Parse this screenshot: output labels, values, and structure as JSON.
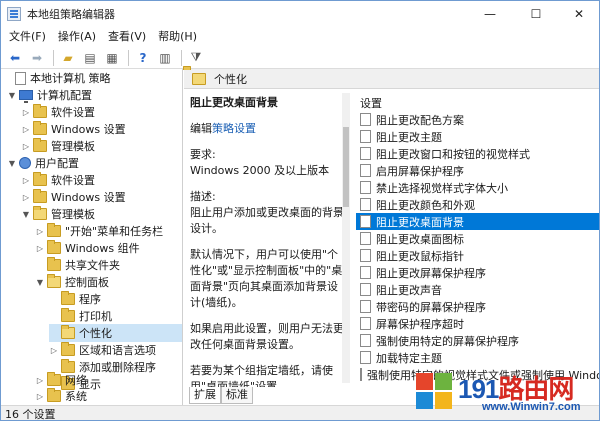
{
  "window": {
    "title": "本地组策略编辑器"
  },
  "menu": [
    "文件(F)",
    "操作(A)",
    "查看(V)",
    "帮助(H)"
  ],
  "tree": {
    "root": "本地计算机 策略",
    "computer_config": "计算机配置",
    "software_settings": "软件设置",
    "windows_settings": "Windows 设置",
    "admin_templates": "管理模板",
    "user_config": "用户配置",
    "user_software_settings": "软件设置",
    "user_windows_settings": "Windows 设置",
    "user_admin_templates": "管理模板",
    "start_menu_taskbar": "\"开始\"菜单和任务栏",
    "windows_components": "Windows 组件",
    "shared_folders": "共享文件夹",
    "control_panel": "控制面板",
    "programs": "程序",
    "printers": "打印机",
    "personalization": "个性化",
    "regional_language": "区域和语言选项",
    "add_remove_programs": "添加或删除程序",
    "display": "显示",
    "network": "网络",
    "system": "系统"
  },
  "pane": {
    "header": "个性化",
    "setting_title": "阻止更改桌面背景",
    "edit_prefix": "编辑",
    "edit_link": "策略设置",
    "requirements_label": "要求:",
    "requirements_value": "Windows 2000 及以上版本",
    "description_label": "描述:",
    "description_value": "阻止用户添加或更改桌面的背景设计。",
    "default_text": "默认情况下，用户可以使用\"个性化\"或\"显示控制面板\"中的\"桌面背景\"页向其桌面添加背景设计(墙纸)。",
    "enable_text": "如果启用此设置，则用户无法更改任何桌面背景设置。",
    "specific_text": "若要为某个组指定墙纸，请使用\"桌面墙纸\"设置。"
  },
  "settings": {
    "column_header": "设置",
    "items": [
      "阻止更改配色方案",
      "阻止更改主题",
      "阻止更改窗口和按钮的视觉样式",
      "启用屏幕保护程序",
      "禁止选择视觉样式字体大小",
      "阻止更改颜色和外观",
      "阻止更改桌面背景",
      "阻止更改桌面图标",
      "阻止更改鼠标指针",
      "阻止更改屏幕保护程序",
      "阻止更改声音",
      "带密码的屏幕保护程序",
      "屏幕保护程序超时",
      "强制使用特定的屏幕保护程序",
      "加载特定主题",
      "强制使用特定的视觉样式文件或强制使用 Windows"
    ],
    "selected_index": 6
  },
  "tabs": [
    "扩展",
    "标准"
  ],
  "status": "16 个设置",
  "watermark": {
    "text_blue": "191",
    "text_red": "路由网",
    "url": "www.Winwin7.com"
  },
  "colors": {
    "selection": "#0078d7",
    "link": "#1a5fb4",
    "folder": "#e8c24e",
    "watermark_blue": "#1c58b3",
    "watermark_red": "#d62a21"
  },
  "icons": [
    "back-arrow-icon",
    "forward-arrow-icon",
    "folder-up-icon",
    "show-hide-tree-icon",
    "export-icon",
    "help-icon",
    "properties-icon",
    "filter-icon"
  ]
}
